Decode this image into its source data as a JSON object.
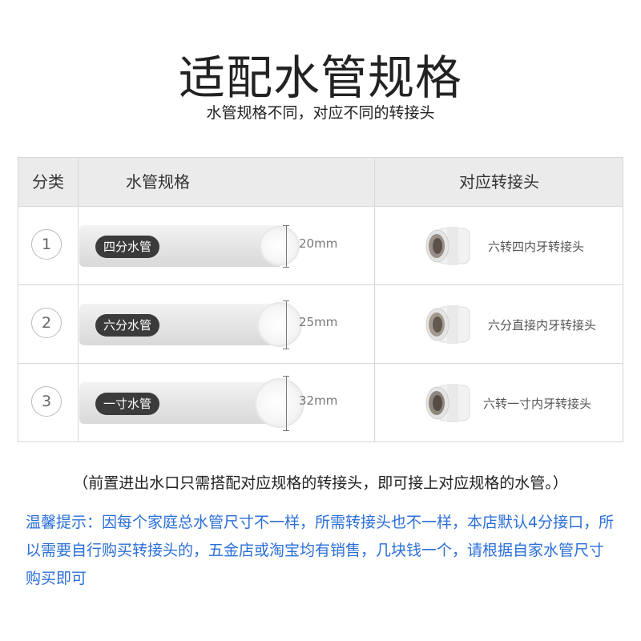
{
  "header": {
    "title": "适配水管规格",
    "subtitle": "水管规格不同，对应不同的转接头"
  },
  "table": {
    "columns": [
      "分类",
      "水管规格",
      "对应转接头"
    ],
    "rows": [
      {
        "index": "1",
        "pipe": "四分水管",
        "size": "20mm",
        "adapter": "六转四内牙转接头"
      },
      {
        "index": "2",
        "pipe": "六分水管",
        "size": "25mm",
        "adapter": "六分直接内牙转接头"
      },
      {
        "index": "3",
        "pipe": "一寸水管",
        "size": "32mm",
        "adapter": "六转一寸内牙转接头"
      }
    ]
  },
  "note": "（前置进出水口只需搭配对应规格的转接头，即可接上对应规格的水管。）",
  "tip": "温馨提示：因每个家庭总水管尺寸不一样，所需转接头也不一样，本店默认4分接口，所以需要自行购买转接头的，五金店或淘宝均有销售，几块钱一个，请根据自家水管尺寸购买即可",
  "colors": {
    "tip_text": "#2b6fd8",
    "header_bg": "#ebebeb",
    "pipe_label_bg": "#3b3b3b"
  }
}
